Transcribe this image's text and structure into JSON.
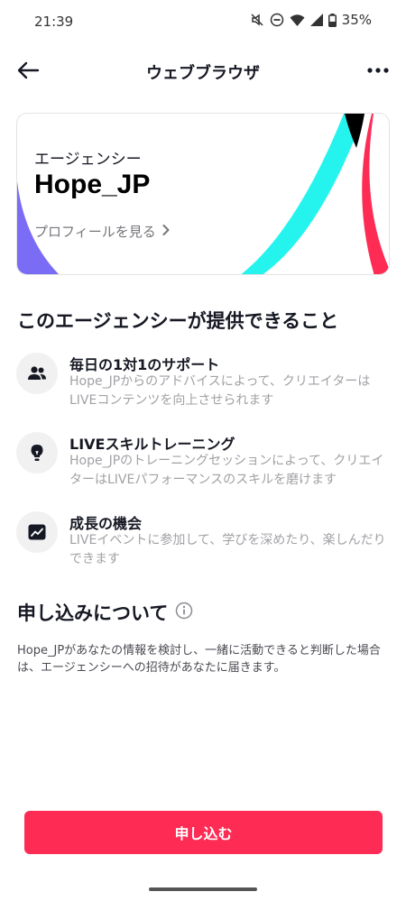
{
  "status_bar": {
    "time": "21:39",
    "battery": "35%",
    "icons": [
      "mute-icon",
      "dnd-icon",
      "wifi-icon",
      "signal-icon",
      "battery-icon"
    ]
  },
  "nav": {
    "title": "ウェブブラウザ",
    "back_icon": "arrow-left-icon",
    "more_icon": "more-horizontal-icon"
  },
  "agency_card": {
    "label": "エージェンシー",
    "name": "Hope_JP",
    "profile_link": "プロフィールを見る",
    "colors": {
      "purple": "#7b6cf6",
      "cyan": "#25f4ee",
      "red": "#fe2c55",
      "black": "#000000"
    }
  },
  "offerings": {
    "title": "このエージェンシーが提供できること",
    "items": [
      {
        "icon": "people-icon",
        "title": "毎日の1対1のサポート",
        "desc": "Hope_JPからのアドバイスによって、クリエイターはLIVEコンテンツを向上させられます"
      },
      {
        "icon": "lightbulb-icon",
        "title": "LIVEスキルトレーニング",
        "desc": "Hope_JPのトレーニングセッションによって、クリエイターはLIVEパフォーマンスのスキルを磨けます"
      },
      {
        "icon": "growth-chart-icon",
        "title": "成長の機会",
        "desc": "LIVEイベントに参加して、学びを深めたり、楽しんだりできます"
      }
    ]
  },
  "application": {
    "title": "申し込みについて",
    "info_icon": "info-icon",
    "desc": "Hope_JPがあなたの情報を検討し、一緒に活動できると判断した場合は、エージェンシーへの招待があなたに届きます。"
  },
  "apply_button": {
    "label": "申し込む",
    "color": "#fe2c55"
  }
}
